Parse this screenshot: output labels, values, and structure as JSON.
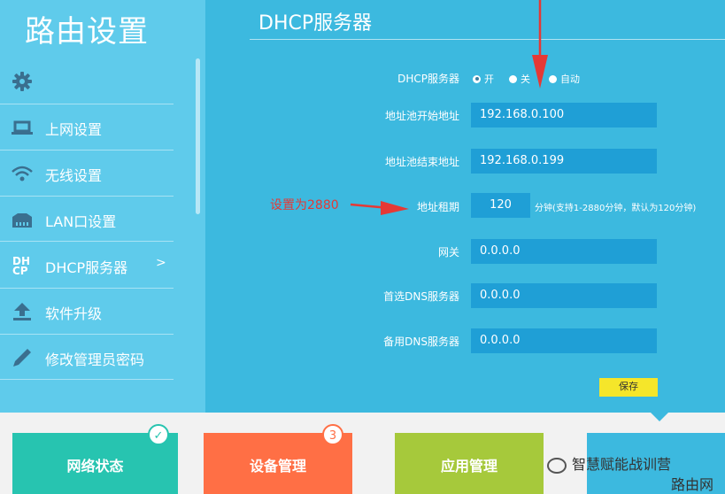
{
  "app": {
    "title": "路由设置"
  },
  "sidebar": {
    "items": [
      {
        "label": "",
        "icon": "gear-icon"
      },
      {
        "label": "上网设置",
        "icon": "laptop-icon"
      },
      {
        "label": "无线设置",
        "icon": "wifi-icon"
      },
      {
        "label": "LAN口设置",
        "icon": "lan-icon"
      },
      {
        "label": "DHCP服务器",
        "icon": "dhcp-icon",
        "arrow": ">"
      },
      {
        "label": "软件升级",
        "icon": "upload-icon"
      },
      {
        "label": "修改管理员密码",
        "icon": "pencil-icon"
      }
    ],
    "dhcp_icon_text": [
      "DH",
      "CP"
    ]
  },
  "main": {
    "title": "DHCP服务器",
    "dhcp_label": "DHCP服务器",
    "radio": {
      "on": "开",
      "off": "关",
      "auto": "自动",
      "selected": "开"
    },
    "fields": [
      {
        "label": "地址池开始地址",
        "value": "192.168.0.100"
      },
      {
        "label": "地址池结束地址",
        "value": "192.168.0.199"
      },
      {
        "label": "地址租期",
        "value": "120",
        "hint": "分钟(支持1-2880分钟，默认为120分钟)"
      },
      {
        "label": "网关",
        "value": "0.0.0.0"
      },
      {
        "label": "首选DNS服务器",
        "value": "0.0.0.0"
      },
      {
        "label": "备用DNS服务器",
        "value": "0.0.0.0"
      }
    ],
    "save_label": "保存"
  },
  "annotation": {
    "text": "设置为2880",
    "color": "#e53935"
  },
  "tiles": [
    {
      "label": "网络状态",
      "color": "#27c4b0",
      "badge": "✓"
    },
    {
      "label": "设备管理",
      "color": "#ff6f45",
      "badge": "3"
    },
    {
      "label": "应用管理",
      "color": "#a6c93b"
    },
    {
      "label": "",
      "color": "#3cb9df"
    }
  ],
  "watermark": {
    "line1": "智慧赋能战训营",
    "line2": "路由网"
  }
}
